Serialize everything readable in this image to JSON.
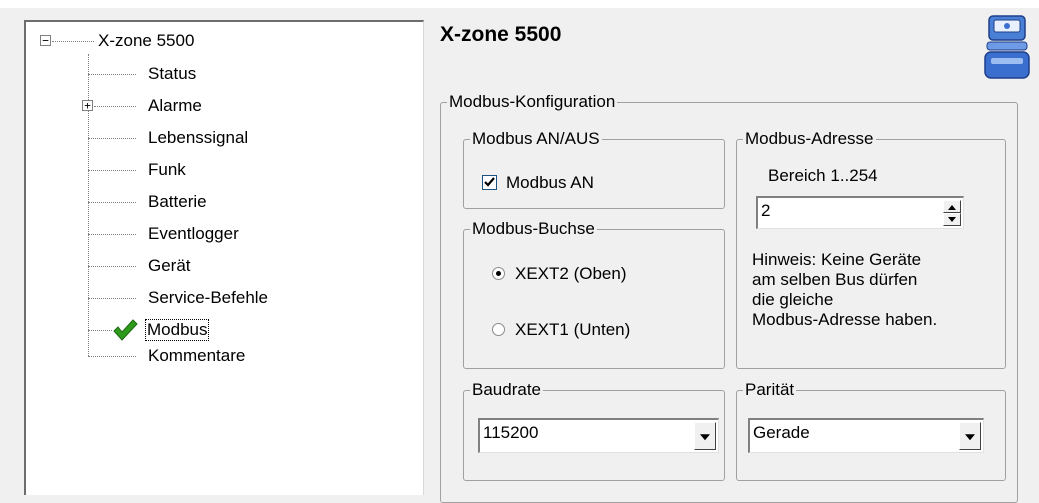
{
  "tree": {
    "root": {
      "label": "X-zone 5500",
      "expander": "−"
    },
    "items": [
      {
        "label": "Status"
      },
      {
        "label": "Alarme",
        "expander": "+"
      },
      {
        "label": "Lebenssignal"
      },
      {
        "label": "Funk"
      },
      {
        "label": "Batterie"
      },
      {
        "label": "Eventlogger"
      },
      {
        "label": "Gerät"
      },
      {
        "label": "Service-Befehle"
      },
      {
        "label": "Modbus",
        "icon": "checkmark-icon",
        "selected": true
      },
      {
        "label": "Kommentare"
      }
    ]
  },
  "page": {
    "title": "X-zone 5500",
    "device_icon": "device-icon"
  },
  "modbus_config": {
    "legend": "Modbus-Konfiguration",
    "onoff": {
      "legend": "Modbus AN/AUS",
      "checkbox_label": "Modbus AN",
      "checked": true
    },
    "socket": {
      "legend": "Modbus-Buchse",
      "options": [
        {
          "label": "XEXT2 (Oben)",
          "selected": true
        },
        {
          "label": "XEXT1 (Unten)",
          "selected": false
        }
      ]
    },
    "address": {
      "legend": "Modbus-Adresse",
      "range": "Bereich 1..254",
      "value": "2",
      "hint": [
        "Hinweis: Keine Geräte",
        "am selben Bus dürfen",
        "die gleiche",
        "Modbus-Adresse haben."
      ]
    },
    "baudrate": {
      "legend": "Baudrate",
      "value": "115200"
    },
    "parity": {
      "legend": "Parität",
      "value": "Gerade"
    }
  },
  "colors": {
    "checkmark": "#2e9a1c",
    "device_icon": "#3b6fcf"
  }
}
